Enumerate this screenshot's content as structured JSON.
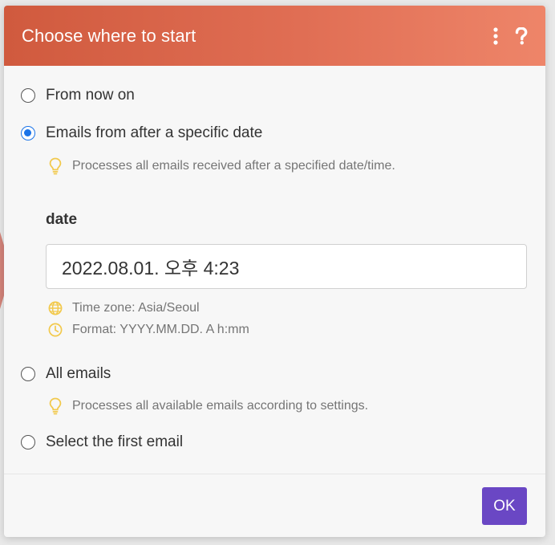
{
  "dialog": {
    "title": "Choose where to start",
    "header_color": "#d96045"
  },
  "options": [
    {
      "label": "From now on",
      "selected": false
    },
    {
      "label": "Emails from after a specific date",
      "selected": true,
      "hint": "Processes all emails received after a specified date/time."
    },
    {
      "label": "All emails",
      "selected": false,
      "hint": "Processes all available emails according to settings."
    },
    {
      "label": "Select the first email",
      "selected": false
    }
  ],
  "date_field": {
    "label": "date",
    "value": "2022.08.01. 오후 4:23",
    "timezone_hint": "Time zone: Asia/Seoul",
    "format_hint": "Format: YYYY.MM.DD. A h:mm"
  },
  "icons": {
    "more": "vertical-dots-icon",
    "help": "question-mark-icon",
    "hint": "lightbulb-icon",
    "timezone": "globe-icon",
    "format": "clock-icon"
  },
  "colors": {
    "accent": "#1a73e8",
    "ok_button": "#6a47c4",
    "hint_icon": "#f2c94c"
  },
  "footer": {
    "ok_label": "OK"
  }
}
